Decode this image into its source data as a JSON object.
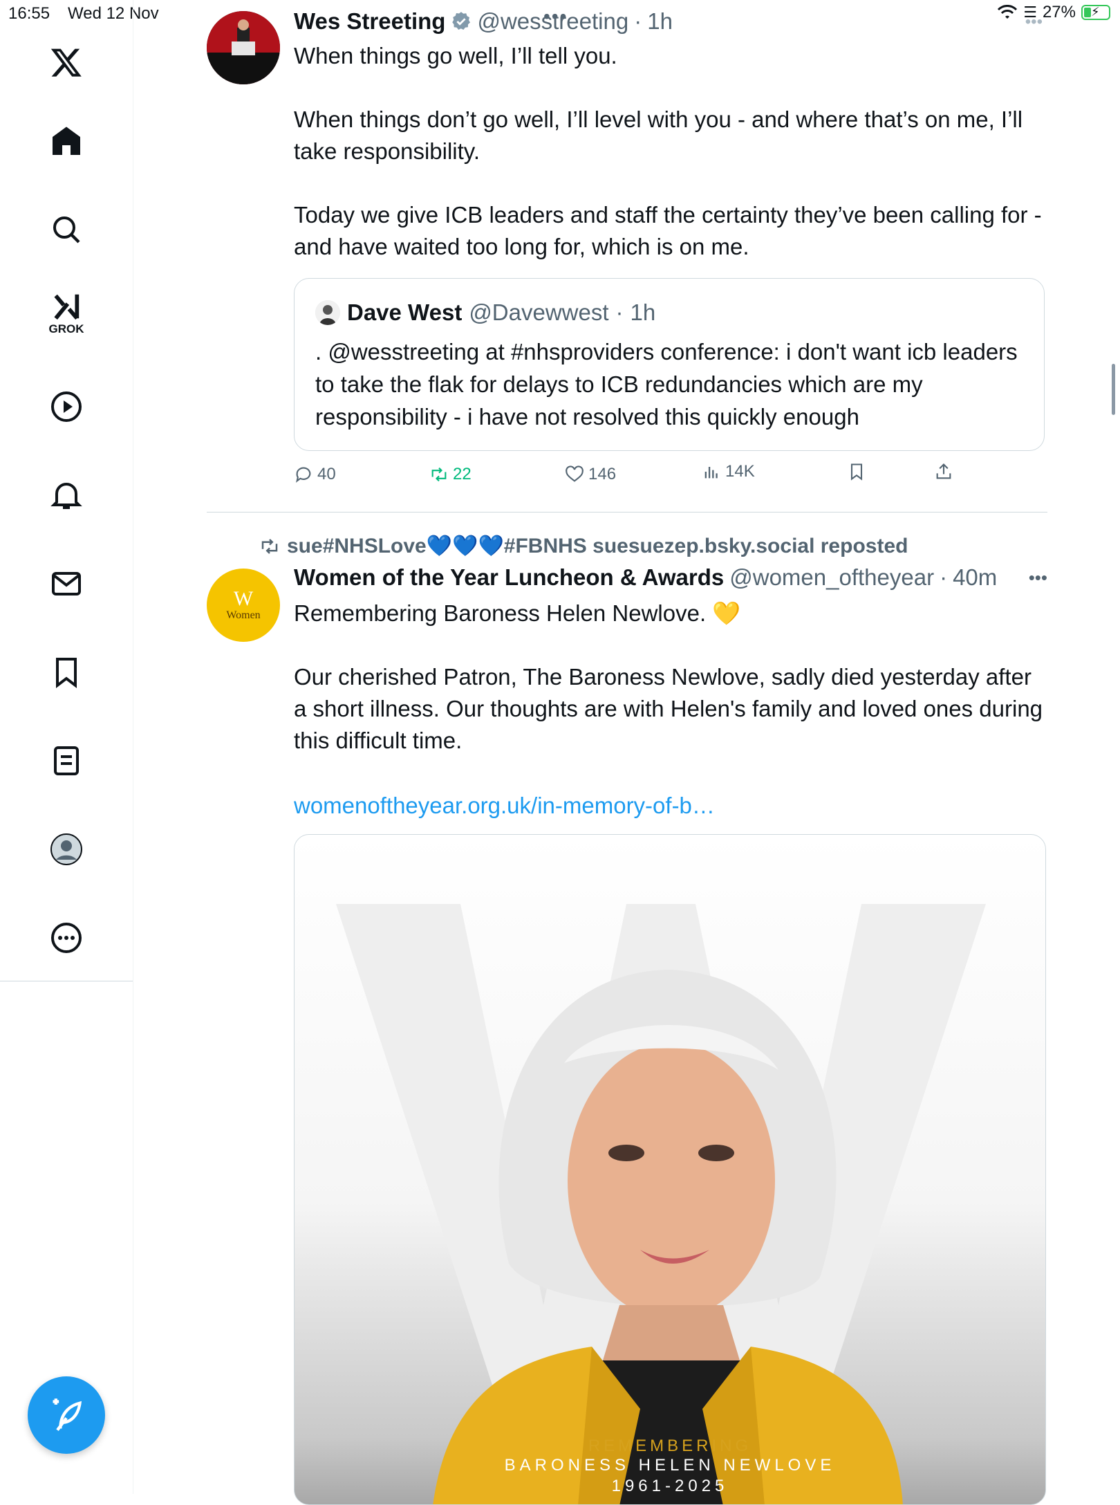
{
  "status_bar": {
    "time": "16:55",
    "date": "Wed 12 Nov",
    "battery": "27%",
    "battery_level": 0.27
  },
  "sidebar": {
    "items": [
      {
        "name": "x-logo-icon"
      },
      {
        "name": "home-icon"
      },
      {
        "name": "search-icon"
      },
      {
        "name": "grok-icon",
        "label": "GROK"
      },
      {
        "name": "video-icon"
      },
      {
        "name": "notifications-icon"
      },
      {
        "name": "messages-icon"
      },
      {
        "name": "bookmarks-icon"
      },
      {
        "name": "lists-icon"
      },
      {
        "name": "profile-icon"
      },
      {
        "name": "more-icon"
      }
    ],
    "compose_icon": "compose-icon"
  },
  "post1": {
    "author": "Wes Streeting",
    "handle": "@wesstreeting",
    "time": "1h",
    "text": "When things go well, I’ll tell you.\n\nWhen things don’t go well, I’ll level with you - and where that’s on me, I’ll take responsibility.\n\nToday we give ICB leaders and staff the certainty they’ve been calling for - and have waited too long for, which is on me.",
    "quote": {
      "author": "Dave West",
      "handle": "@Davewwest",
      "time": "1h",
      "text": ". @wesstreeting at #nhsproviders conference: i don't want icb leaders to take the flak for delays to ICB redundancies which are my responsibility  - i have not resolved this quickly enough"
    },
    "actions": {
      "replies": "40",
      "reposts": "22",
      "likes": "146",
      "views": "14K"
    }
  },
  "post2": {
    "repost_by": "sue#NHSLove💙💙💙#FBNHS suesuezep.bsky.social reposted",
    "author": "Women of the Year Luncheon & Awards",
    "handle": "@women_oftheyear",
    "time": "40m",
    "avatar_text": "Women",
    "avatar_letter": "W",
    "text": "Remembering Baroness Helen Newlove. 💛\n\nOur cherished Patron, The Baroness Newlove, sadly died yesterday after a short illness. Our thoughts are with Helen's family and loved ones during this difficult time.",
    "link": "womenoftheyear.org.uk/in-memory-of-b…",
    "media": {
      "line1": "REMEMBERING",
      "line2": "BARONESS HELEN NEWLOVE",
      "line3": "1961-2025"
    }
  },
  "colors": {
    "accent": "#1d9bf0",
    "repost_green": "#00ba7c",
    "muted": "#536471",
    "avatar_yellow": "#f5c400"
  }
}
